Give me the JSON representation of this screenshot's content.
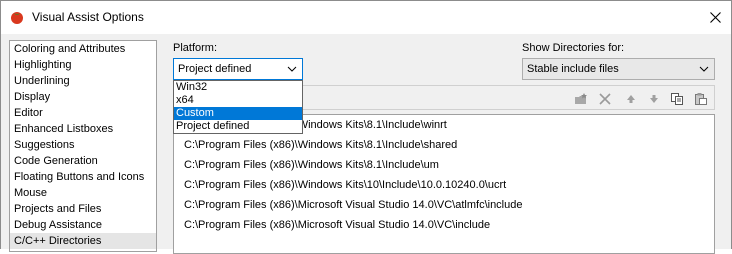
{
  "window": {
    "title": "Visual Assist Options"
  },
  "sidebar": {
    "items": [
      "Coloring and Attributes",
      "Highlighting",
      "Underlining",
      "Display",
      "Editor",
      "Enhanced Listboxes",
      "Suggestions",
      "Code Generation",
      "Floating Buttons and Icons",
      "Mouse",
      "Projects and Files",
      "Debug Assistance",
      "C/C++ Directories"
    ],
    "selected": "C/C++ Directories"
  },
  "platform": {
    "label": "Platform:",
    "value": "Project defined",
    "options": [
      "Win32",
      "x64",
      "Custom",
      "Project defined"
    ],
    "highlighted": "Custom"
  },
  "show_directories": {
    "label": "Show Directories for:",
    "value": "Stable include files"
  },
  "toolbar": {
    "icons": [
      "new-folder-icon",
      "delete-icon",
      "move-up-icon",
      "move-down-icon",
      "copy-icon",
      "paste-icon"
    ]
  },
  "directories": [
    "C:\\Program Files (x86)\\Windows Kits\\8.1\\Include\\winrt",
    "C:\\Program Files (x86)\\Windows Kits\\8.1\\Include\\shared",
    "C:\\Program Files (x86)\\Windows Kits\\8.1\\Include\\um",
    "C:\\Program Files (x86)\\Windows Kits\\10\\Include\\10.0.10240.0\\ucrt",
    "C:\\Program Files (x86)\\Microsoft Visual Studio 14.0\\VC\\atlmfc\\include",
    "C:\\Program Files (x86)\\Microsoft Visual Studio 14.0\\VC\\include"
  ],
  "colors": {
    "accent": "#0078d7",
    "selected_bg": "#e5e5e5"
  }
}
